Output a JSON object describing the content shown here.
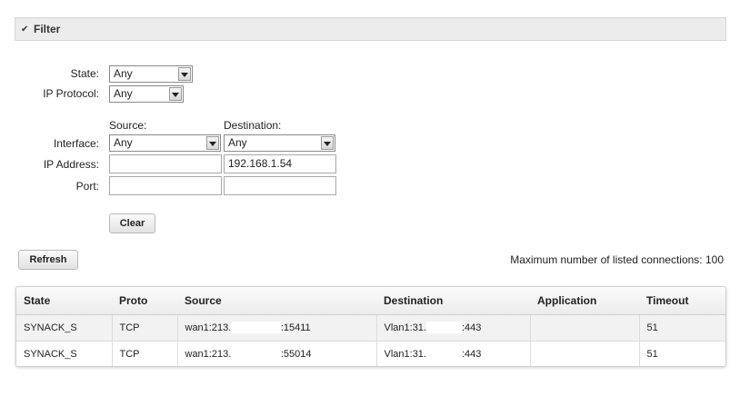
{
  "filter": {
    "title": "Filter",
    "state_label": "State:",
    "state_value": "Any",
    "protocol_label": "IP Protocol:",
    "protocol_value": "Any",
    "source_header": "Source:",
    "destination_header": "Destination:",
    "interface_label": "Interface:",
    "source_interface": "Any",
    "destination_interface": "Any",
    "ip_label": "IP Address:",
    "source_ip": "",
    "destination_ip": "192.168.1.54",
    "port_label": "Port:",
    "source_port": "",
    "destination_port": "",
    "clear_label": "Clear"
  },
  "toolbar": {
    "refresh_label": "Refresh",
    "max_connections": "Maximum number of listed connections: 100"
  },
  "table": {
    "columns": [
      "State",
      "Proto",
      "Source",
      "Destination",
      "Application",
      "Timeout"
    ],
    "rows": [
      [
        "SYNACK_S",
        "TCP",
        "wan1:213.███████:15411",
        "Vlan1:31.█████:443",
        "",
        "51"
      ],
      [
        "SYNACK_S",
        "TCP",
        "wan1:213.███████:55014",
        "Vlan1:31.█████:443",
        "",
        "51"
      ]
    ]
  },
  "colors": {
    "filter_bar_bg": "#ececec",
    "redaction": "#ffffff"
  },
  "icons": {
    "filter_toggle": "chevron-down-icon",
    "select_arrow": "dropdown-arrow-icon"
  }
}
